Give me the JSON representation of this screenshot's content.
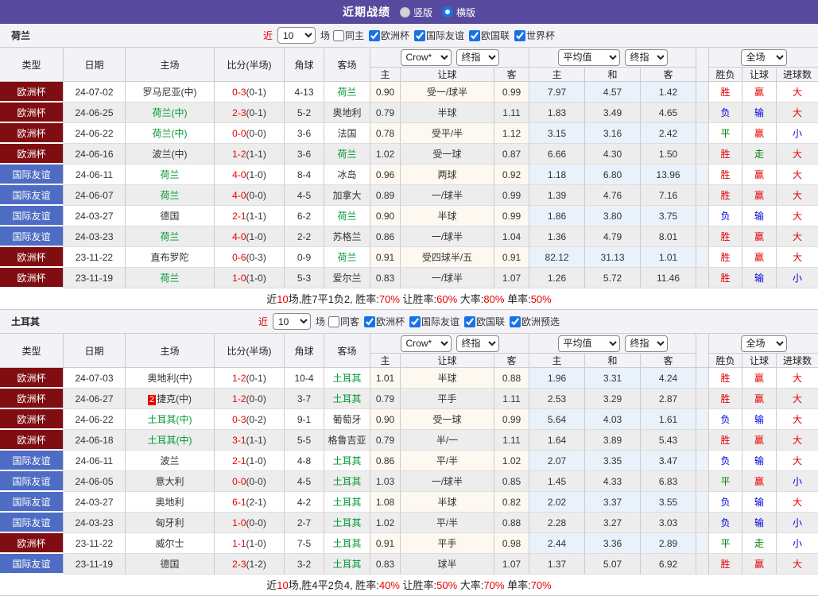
{
  "topbar": {
    "title": "近期战绩",
    "radios": [
      {
        "label": "竖版",
        "checked": false
      },
      {
        "label": "横版",
        "checked": true
      }
    ]
  },
  "filter_common": {
    "near": "近",
    "games": "场"
  },
  "table_header": {
    "left_cols": [
      "类型",
      "日期",
      "主场",
      "比分(半场)",
      "角球",
      "客场"
    ],
    "odds_group_dropdowns": [
      "Crow*",
      "终指"
    ],
    "avg_group_dropdowns": [
      "平均值",
      "终指"
    ],
    "result_group_dropdowns": [
      "全场"
    ],
    "sub_cols": [
      "主",
      "让球",
      "客",
      "主",
      "和",
      "客",
      "胜负",
      "让球",
      "进球数"
    ]
  },
  "colors": {
    "accent_purple": "#574a9e",
    "league_cup": "#7f0d12",
    "league_friendly": "#4e6cc3",
    "team_highlight_green": "#009933",
    "win_red": "#e60000",
    "lose_blue": "#0000e0",
    "draw_green": "#008000",
    "odds_col_bg": "#fdf8f0",
    "avg_col_bg": "#e9f2fa"
  },
  "sections": [
    {
      "team": "荷兰",
      "filter": {
        "count": "10",
        "same": "同主",
        "same_checked": false,
        "leagues": [
          {
            "label": "欧洲杯",
            "checked": true
          },
          {
            "label": "国际友谊",
            "checked": true
          },
          {
            "label": "欧国联",
            "checked": true
          },
          {
            "label": "世界杯",
            "checked": true
          }
        ]
      },
      "rows": [
        {
          "league": "欧洲杯",
          "league_style": "cup",
          "date": "24-07-02",
          "home": "罗马尼亚(中)",
          "home_hl": false,
          "red_card": false,
          "ft": "0-3",
          "ht": "(0-1)",
          "corner": "4-13",
          "away": "荷兰",
          "away_hl": true,
          "odds": [
            "0.90",
            "受一/球半",
            "0.99"
          ],
          "avg": [
            "7.97",
            "4.57",
            "1.42"
          ],
          "results": [
            {
              "text": "胜",
              "color": "r"
            },
            {
              "text": "赢",
              "color": "r"
            },
            {
              "text": "大",
              "color": "r"
            }
          ]
        },
        {
          "league": "欧洲杯",
          "league_style": "cup",
          "date": "24-06-25",
          "home": "荷兰(中)",
          "home_hl": true,
          "red_card": false,
          "ft": "2-3",
          "ht": "(0-1)",
          "corner": "5-2",
          "away": "奥地利",
          "away_hl": false,
          "odds": [
            "0.79",
            "半球",
            "1.11"
          ],
          "avg": [
            "1.83",
            "3.49",
            "4.65"
          ],
          "results": [
            {
              "text": "负",
              "color": "b"
            },
            {
              "text": "输",
              "color": "b"
            },
            {
              "text": "大",
              "color": "r"
            }
          ]
        },
        {
          "league": "欧洲杯",
          "league_style": "cup",
          "date": "24-06-22",
          "home": "荷兰(中)",
          "home_hl": true,
          "red_card": false,
          "ft": "0-0",
          "ht": "(0-0)",
          "corner": "3-6",
          "away": "法国",
          "away_hl": false,
          "odds": [
            "0.78",
            "受平/半",
            "1.12"
          ],
          "avg": [
            "3.15",
            "3.16",
            "2.42"
          ],
          "results": [
            {
              "text": "平",
              "color": "g"
            },
            {
              "text": "赢",
              "color": "r"
            },
            {
              "text": "小",
              "color": "b"
            }
          ]
        },
        {
          "league": "欧洲杯",
          "league_style": "cup",
          "date": "24-06-16",
          "home": "波兰(中)",
          "home_hl": false,
          "red_card": false,
          "ft": "1-2",
          "ht": "(1-1)",
          "corner": "3-6",
          "away": "荷兰",
          "away_hl": true,
          "odds": [
            "1.02",
            "受一球",
            "0.87"
          ],
          "avg": [
            "6.66",
            "4.30",
            "1.50"
          ],
          "results": [
            {
              "text": "胜",
              "color": "r"
            },
            {
              "text": "走",
              "color": "g"
            },
            {
              "text": "大",
              "color": "r"
            }
          ]
        },
        {
          "league": "国际友谊",
          "league_style": "friendly",
          "date": "24-06-11",
          "home": "荷兰",
          "home_hl": true,
          "red_card": false,
          "ft": "4-0",
          "ht": "(1-0)",
          "corner": "8-4",
          "away": "冰岛",
          "away_hl": false,
          "odds": [
            "0.96",
            "两球",
            "0.92"
          ],
          "avg": [
            "1.18",
            "6.80",
            "13.96"
          ],
          "results": [
            {
              "text": "胜",
              "color": "r"
            },
            {
              "text": "赢",
              "color": "r"
            },
            {
              "text": "大",
              "color": "r"
            }
          ]
        },
        {
          "league": "国际友谊",
          "league_style": "friendly",
          "date": "24-06-07",
          "home": "荷兰",
          "home_hl": true,
          "red_card": false,
          "ft": "4-0",
          "ht": "(0-0)",
          "corner": "4-5",
          "away": "加拿大",
          "away_hl": false,
          "odds": [
            "0.89",
            "一/球半",
            "0.99"
          ],
          "avg": [
            "1.39",
            "4.76",
            "7.16"
          ],
          "results": [
            {
              "text": "胜",
              "color": "r"
            },
            {
              "text": "赢",
              "color": "r"
            },
            {
              "text": "大",
              "color": "r"
            }
          ]
        },
        {
          "league": "国际友谊",
          "league_style": "friendly",
          "date": "24-03-27",
          "home": "德国",
          "home_hl": false,
          "red_card": false,
          "ft": "2-1",
          "ht": "(1-1)",
          "corner": "6-2",
          "away": "荷兰",
          "away_hl": true,
          "odds": [
            "0.90",
            "半球",
            "0.99"
          ],
          "avg": [
            "1.86",
            "3.80",
            "3.75"
          ],
          "results": [
            {
              "text": "负",
              "color": "b"
            },
            {
              "text": "输",
              "color": "b"
            },
            {
              "text": "大",
              "color": "r"
            }
          ]
        },
        {
          "league": "国际友谊",
          "league_style": "friendly",
          "date": "24-03-23",
          "home": "荷兰",
          "home_hl": true,
          "red_card": false,
          "ft": "4-0",
          "ht": "(1-0)",
          "corner": "2-2",
          "away": "苏格兰",
          "away_hl": false,
          "odds": [
            "0.86",
            "一/球半",
            "1.04"
          ],
          "avg": [
            "1.36",
            "4.79",
            "8.01"
          ],
          "results": [
            {
              "text": "胜",
              "color": "r"
            },
            {
              "text": "赢",
              "color": "r"
            },
            {
              "text": "大",
              "color": "r"
            }
          ]
        },
        {
          "league": "欧洲杯",
          "league_style": "cup",
          "date": "23-11-22",
          "home": "直布罗陀",
          "home_hl": false,
          "red_card": false,
          "ft": "0-6",
          "ht": "(0-3)",
          "corner": "0-9",
          "away": "荷兰",
          "away_hl": true,
          "odds": [
            "0.91",
            "受四球半/五",
            "0.91"
          ],
          "avg": [
            "82.12",
            "31.13",
            "1.01"
          ],
          "results": [
            {
              "text": "胜",
              "color": "r"
            },
            {
              "text": "赢",
              "color": "r"
            },
            {
              "text": "大",
              "color": "r"
            }
          ]
        },
        {
          "league": "欧洲杯",
          "league_style": "cup",
          "date": "23-11-19",
          "home": "荷兰",
          "home_hl": true,
          "red_card": false,
          "ft": "1-0",
          "ht": "(1-0)",
          "corner": "5-3",
          "away": "爱尔兰",
          "away_hl": false,
          "odds": [
            "0.83",
            "一/球半",
            "1.07"
          ],
          "avg": [
            "1.26",
            "5.72",
            "11.46"
          ],
          "results": [
            {
              "text": "胜",
              "color": "r"
            },
            {
              "text": "输",
              "color": "b"
            },
            {
              "text": "小",
              "color": "b"
            }
          ]
        }
      ],
      "summary": [
        {
          "text": "近",
          "red": false
        },
        {
          "text": "10",
          "red": true
        },
        {
          "text": "场,胜7平1负2, 胜率:",
          "red": false
        },
        {
          "text": "70%",
          "red": true
        },
        {
          "text": " 让胜率:",
          "red": false
        },
        {
          "text": "60%",
          "red": true
        },
        {
          "text": " 大率:",
          "red": false
        },
        {
          "text": "80%",
          "red": true
        },
        {
          "text": " 单率:",
          "red": false
        },
        {
          "text": "50%",
          "red": true
        }
      ]
    },
    {
      "team": "土耳其",
      "filter": {
        "count": "10",
        "same": "同客",
        "same_checked": false,
        "leagues": [
          {
            "label": "欧洲杯",
            "checked": true
          },
          {
            "label": "国际友谊",
            "checked": true
          },
          {
            "label": "欧国联",
            "checked": true
          },
          {
            "label": "欧洲预选",
            "checked": true
          }
        ]
      },
      "rows": [
        {
          "league": "欧洲杯",
          "league_style": "cup",
          "date": "24-07-03",
          "home": "奥地利(中)",
          "home_hl": false,
          "red_card": false,
          "ft": "1-2",
          "ht": "(0-1)",
          "corner": "10-4",
          "away": "土耳其",
          "away_hl": true,
          "odds": [
            "1.01",
            "半球",
            "0.88"
          ],
          "avg": [
            "1.96",
            "3.31",
            "4.24"
          ],
          "results": [
            {
              "text": "胜",
              "color": "r"
            },
            {
              "text": "赢",
              "color": "r"
            },
            {
              "text": "大",
              "color": "r"
            }
          ]
        },
        {
          "league": "欧洲杯",
          "league_style": "cup",
          "date": "24-06-27",
          "home": "捷克(中)",
          "home_hl": false,
          "red_card": true,
          "red_card_count": "2",
          "ft": "1-2",
          "ht": "(0-0)",
          "corner": "3-7",
          "away": "土耳其",
          "away_hl": true,
          "odds": [
            "0.79",
            "平手",
            "1.11"
          ],
          "avg": [
            "2.53",
            "3.29",
            "2.87"
          ],
          "results": [
            {
              "text": "胜",
              "color": "r"
            },
            {
              "text": "赢",
              "color": "r"
            },
            {
              "text": "大",
              "color": "r"
            }
          ]
        },
        {
          "league": "欧洲杯",
          "league_style": "cup",
          "date": "24-06-22",
          "home": "土耳其(中)",
          "home_hl": true,
          "red_card": false,
          "ft": "0-3",
          "ht": "(0-2)",
          "corner": "9-1",
          "away": "葡萄牙",
          "away_hl": false,
          "odds": [
            "0.90",
            "受一球",
            "0.99"
          ],
          "avg": [
            "5.64",
            "4.03",
            "1.61"
          ],
          "results": [
            {
              "text": "负",
              "color": "b"
            },
            {
              "text": "输",
              "color": "b"
            },
            {
              "text": "大",
              "color": "r"
            }
          ]
        },
        {
          "league": "欧洲杯",
          "league_style": "cup",
          "date": "24-06-18",
          "home": "土耳其(中)",
          "home_hl": true,
          "red_card": false,
          "ft": "3-1",
          "ht": "(1-1)",
          "corner": "5-5",
          "away": "格鲁吉亚",
          "away_hl": false,
          "odds": [
            "0.79",
            "半/一",
            "1.11"
          ],
          "avg": [
            "1.64",
            "3.89",
            "5.43"
          ],
          "results": [
            {
              "text": "胜",
              "color": "r"
            },
            {
              "text": "赢",
              "color": "r"
            },
            {
              "text": "大",
              "color": "r"
            }
          ]
        },
        {
          "league": "国际友谊",
          "league_style": "friendly",
          "date": "24-06-11",
          "home": "波兰",
          "home_hl": false,
          "red_card": false,
          "ft": "2-1",
          "ht": "(1-0)",
          "corner": "4-8",
          "away": "土耳其",
          "away_hl": true,
          "odds": [
            "0.86",
            "平/半",
            "1.02"
          ],
          "avg": [
            "2.07",
            "3.35",
            "3.47"
          ],
          "results": [
            {
              "text": "负",
              "color": "b"
            },
            {
              "text": "输",
              "color": "b"
            },
            {
              "text": "大",
              "color": "r"
            }
          ]
        },
        {
          "league": "国际友谊",
          "league_style": "friendly",
          "date": "24-06-05",
          "home": "意大利",
          "home_hl": false,
          "red_card": false,
          "ft": "0-0",
          "ht": "(0-0)",
          "corner": "4-5",
          "away": "土耳其",
          "away_hl": true,
          "odds": [
            "1.03",
            "一/球半",
            "0.85"
          ],
          "avg": [
            "1.45",
            "4.33",
            "6.83"
          ],
          "results": [
            {
              "text": "平",
              "color": "g"
            },
            {
              "text": "赢",
              "color": "r"
            },
            {
              "text": "小",
              "color": "b"
            }
          ]
        },
        {
          "league": "国际友谊",
          "league_style": "friendly",
          "date": "24-03-27",
          "home": "奥地利",
          "home_hl": false,
          "red_card": false,
          "ft": "6-1",
          "ht": "(2-1)",
          "corner": "4-2",
          "away": "土耳其",
          "away_hl": true,
          "odds": [
            "1.08",
            "半球",
            "0.82"
          ],
          "avg": [
            "2.02",
            "3.37",
            "3.55"
          ],
          "results": [
            {
              "text": "负",
              "color": "b"
            },
            {
              "text": "输",
              "color": "b"
            },
            {
              "text": "大",
              "color": "r"
            }
          ]
        },
        {
          "league": "国际友谊",
          "league_style": "friendly",
          "date": "24-03-23",
          "home": "匈牙利",
          "home_hl": false,
          "red_card": false,
          "ft": "1-0",
          "ht": "(0-0)",
          "corner": "2-7",
          "away": "土耳其",
          "away_hl": true,
          "odds": [
            "1.02",
            "平/半",
            "0.88"
          ],
          "avg": [
            "2.28",
            "3.27",
            "3.03"
          ],
          "results": [
            {
              "text": "负",
              "color": "b"
            },
            {
              "text": "输",
              "color": "b"
            },
            {
              "text": "小",
              "color": "b"
            }
          ]
        },
        {
          "league": "欧洲杯",
          "league_style": "cup",
          "date": "23-11-22",
          "home": "威尔士",
          "home_hl": false,
          "red_card": false,
          "ft": "1-1",
          "ht": "(1-0)",
          "corner": "7-5",
          "away": "土耳其",
          "away_hl": true,
          "odds": [
            "0.91",
            "平手",
            "0.98"
          ],
          "avg": [
            "2.44",
            "3.36",
            "2.89"
          ],
          "results": [
            {
              "text": "平",
              "color": "g"
            },
            {
              "text": "走",
              "color": "g"
            },
            {
              "text": "小",
              "color": "b"
            }
          ]
        },
        {
          "league": "国际友谊",
          "league_style": "friendly",
          "date": "23-11-19",
          "home": "德国",
          "home_hl": false,
          "red_card": false,
          "ft": "2-3",
          "ht": "(1-2)",
          "corner": "3-2",
          "away": "土耳其",
          "away_hl": true,
          "odds": [
            "0.83",
            "球半",
            "1.07"
          ],
          "avg": [
            "1.37",
            "5.07",
            "6.92"
          ],
          "results": [
            {
              "text": "胜",
              "color": "r"
            },
            {
              "text": "赢",
              "color": "r"
            },
            {
              "text": "大",
              "color": "r"
            }
          ]
        }
      ],
      "summary": [
        {
          "text": "近",
          "red": false
        },
        {
          "text": "10",
          "red": true
        },
        {
          "text": "场,胜4平2负4, 胜率:",
          "red": false
        },
        {
          "text": "40%",
          "red": true
        },
        {
          "text": " 让胜率:",
          "red": false
        },
        {
          "text": "50%",
          "red": true
        },
        {
          "text": " 大率:",
          "red": false
        },
        {
          "text": "70%",
          "red": true
        },
        {
          "text": " 单率:",
          "red": false
        },
        {
          "text": "70%",
          "red": true
        }
      ]
    }
  ]
}
